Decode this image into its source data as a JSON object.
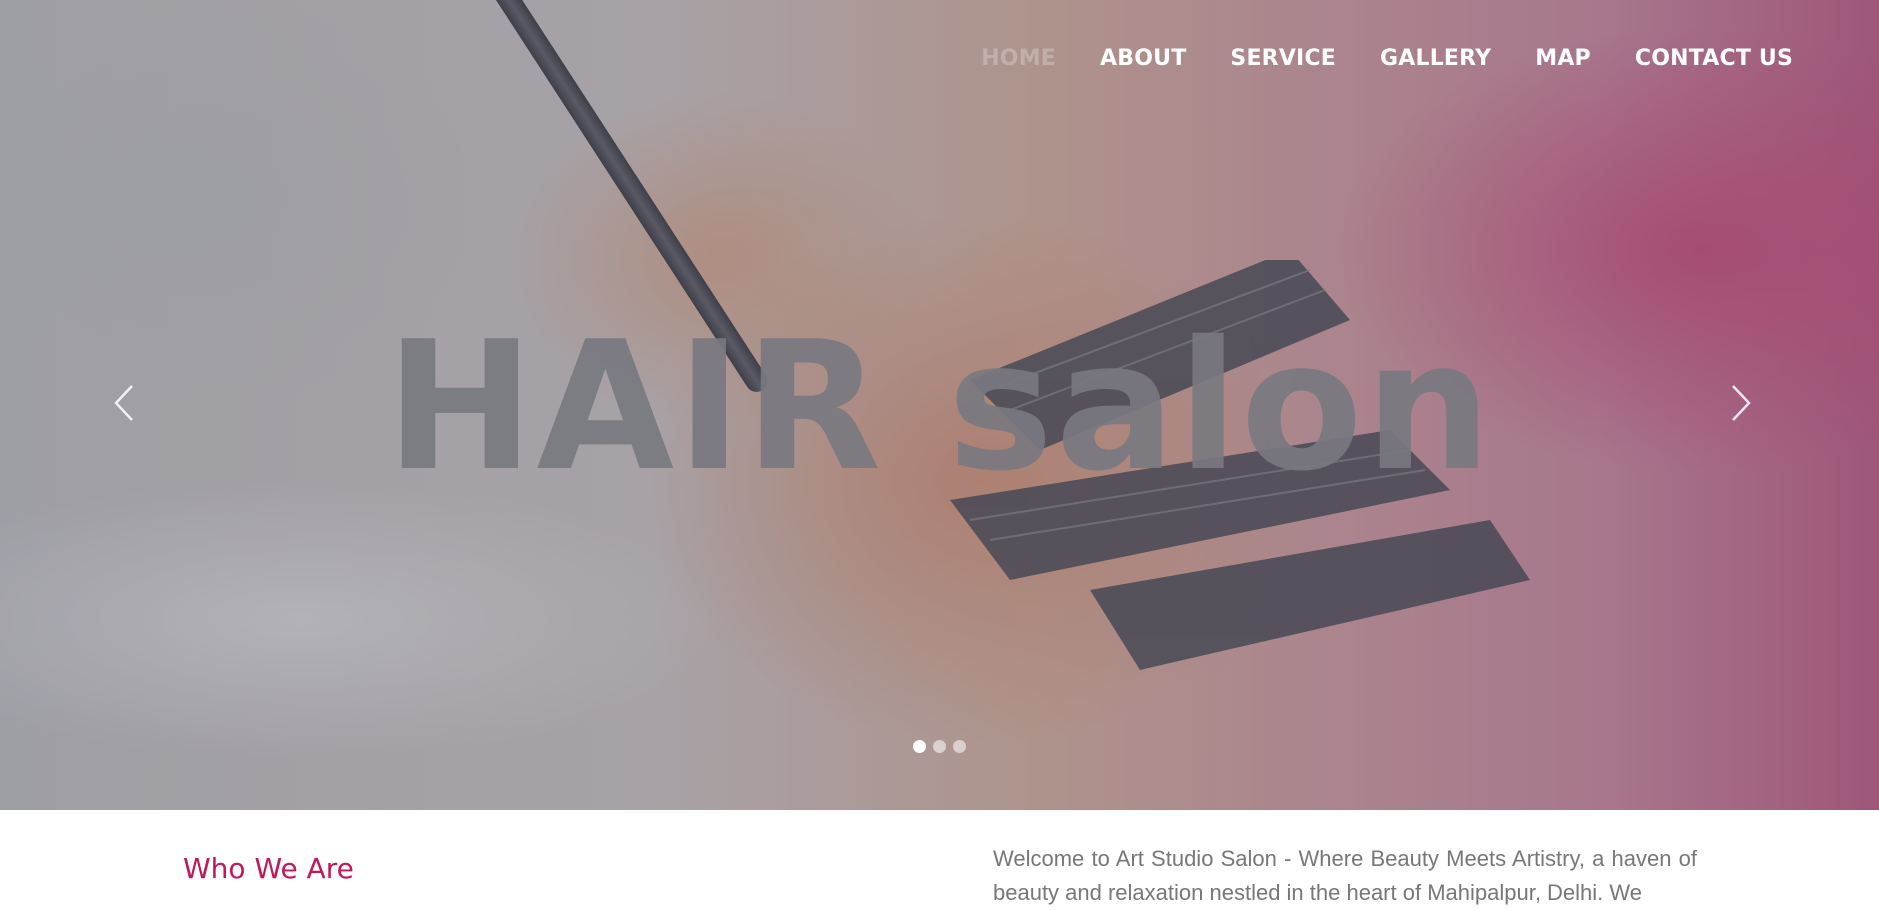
{
  "nav": {
    "items": [
      {
        "label": "HOME"
      },
      {
        "label": "ABOUT"
      },
      {
        "label": "SERVICE"
      },
      {
        "label": "GALLERY"
      },
      {
        "label": "MAP"
      },
      {
        "label": "CONTACT US"
      }
    ]
  },
  "hero": {
    "title": "HAIR salon",
    "slide_count": 3,
    "active_slide": 1,
    "prev_icon": "chevron-left-icon",
    "next_icon": "chevron-right-icon"
  },
  "about": {
    "heading": "Who We Are",
    "intro": "Welcome to Art Studio Salon - Where Beauty Meets Artistry, a haven of beauty and relaxation nestled in the heart of Mahipalpur, Delhi. We"
  },
  "colors": {
    "accent": "#c2185b",
    "nav_text": "#ffffff",
    "body_text": "#777777"
  }
}
